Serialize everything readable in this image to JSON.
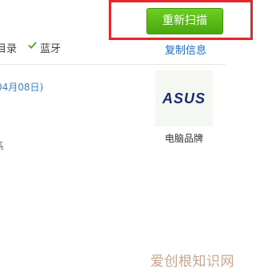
{
  "toolbar": {
    "rescan_label": "重新扫描"
  },
  "status": {
    "item1": "目录",
    "item2": "蓝牙",
    "item2_check_icon": "check-icon"
  },
  "actions": {
    "copy_info": "复制信息"
  },
  "info": {
    "date_fragment": "04月08日)",
    "cut_fragment": "系"
  },
  "brand": {
    "logo_text": "ASUS",
    "label": "电脑品牌",
    "logo_color": "#1a2a6e"
  },
  "watermark": "爱创根知识网",
  "colors": {
    "button_green": "#5bbd17",
    "highlight_red": "#e5262d",
    "link_blue": "#1a6fcc"
  }
}
